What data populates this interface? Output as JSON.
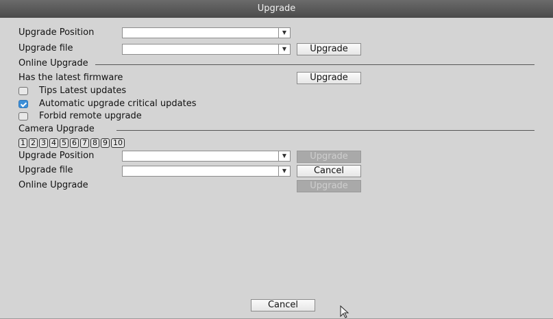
{
  "title": "Upgrade",
  "local": {
    "position_label": "Upgrade Position",
    "file_label": "Upgrade file",
    "upgrade_button": "Upgrade",
    "position_value": "",
    "file_value": ""
  },
  "online": {
    "section": "Online Upgrade",
    "status": "Has the latest firmware",
    "upgrade_button": "Upgrade",
    "options": [
      {
        "label": "Tips Latest updates",
        "checked": false
      },
      {
        "label": "Automatic upgrade critical updates",
        "checked": true
      },
      {
        "label": "Forbid remote upgrade",
        "checked": false
      }
    ]
  },
  "camera": {
    "section": "Camera Upgrade",
    "channels": [
      "1",
      "2",
      "3",
      "4",
      "5",
      "6",
      "7",
      "8",
      "9",
      "10"
    ],
    "position_label": "Upgrade Position",
    "file_label": "Upgrade file",
    "online_label": "Online Upgrade",
    "upgrade_button": "Upgrade",
    "cancel_button": "Cancel",
    "online_button": "Upgrade"
  },
  "footer": {
    "cancel_button": "Cancel"
  },
  "icons": {
    "dropdown": "chevron-down-icon",
    "check": "checkmark-icon",
    "cursor": "mouse-pointer-icon"
  },
  "colors": {
    "title_bar": "#555555",
    "window_bg": "#d4d4d4",
    "checkbox_on": "#3c8fd8"
  }
}
